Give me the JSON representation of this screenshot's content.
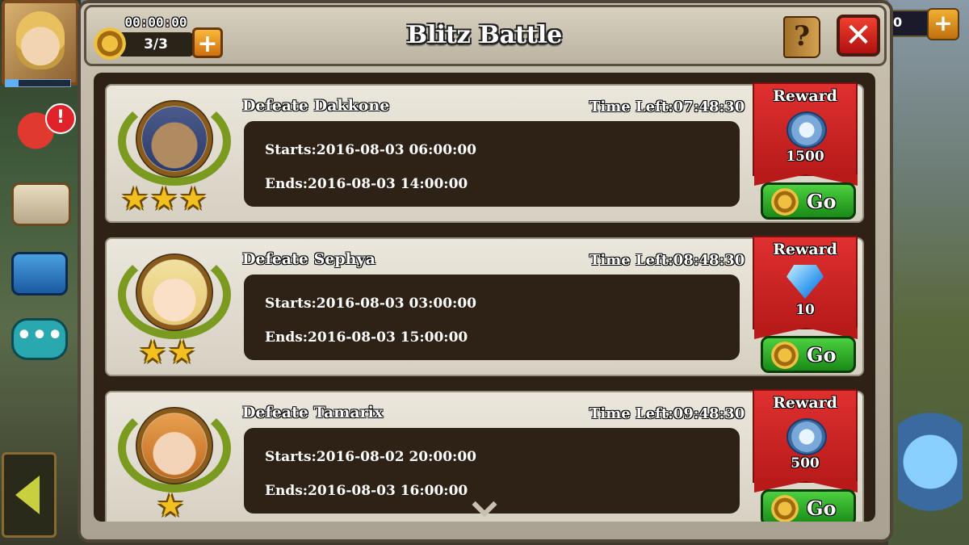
{
  "header": {
    "title": "Blitz Battle",
    "timer": "00:00:00",
    "stamina": "3/3",
    "plus_symbol": "+",
    "help_symbol": "?",
    "close_symbol": "✕"
  },
  "sidebar": {
    "badge": "!",
    "chat_symbol": "•••"
  },
  "resource": {
    "value": "0",
    "plus_symbol": "+"
  },
  "battles": [
    {
      "title": "Defeate Dakkone",
      "time_left": "Time Left:07:48:30",
      "starts": "Starts:2016-08-03 06:00:00",
      "ends": "Ends:2016-08-03 14:00:00",
      "stars": "★★★",
      "star_count": 3,
      "reward_label": "Reward",
      "reward_icon": "silver-coins-icon",
      "reward_value": "1500",
      "go_label": "Go"
    },
    {
      "title": "Defeate Sephya",
      "time_left": "Time Left:08:48:30",
      "starts": "Starts:2016-08-03 03:00:00",
      "ends": "Ends:2016-08-03 15:00:00",
      "stars": "★★",
      "star_count": 2,
      "reward_label": "Reward",
      "reward_icon": "blue-diamond-icon",
      "reward_value": "10",
      "go_label": "Go"
    },
    {
      "title": "Defeate Tamarix",
      "time_left": "Time Left:09:48:30",
      "starts": "Starts:2016-08-02 20:00:00",
      "ends": "Ends:2016-08-03 16:00:00",
      "stars": "★",
      "star_count": 1,
      "reward_label": "Reward",
      "reward_icon": "silver-coins-icon",
      "reward_value": "500",
      "go_label": "Go"
    }
  ],
  "colors": {
    "panel": "#c9c2b0",
    "dark_box": "#2e2116",
    "reward_red": "#e03030",
    "go_green": "#4cd040",
    "star_gold": "#f4c020"
  }
}
